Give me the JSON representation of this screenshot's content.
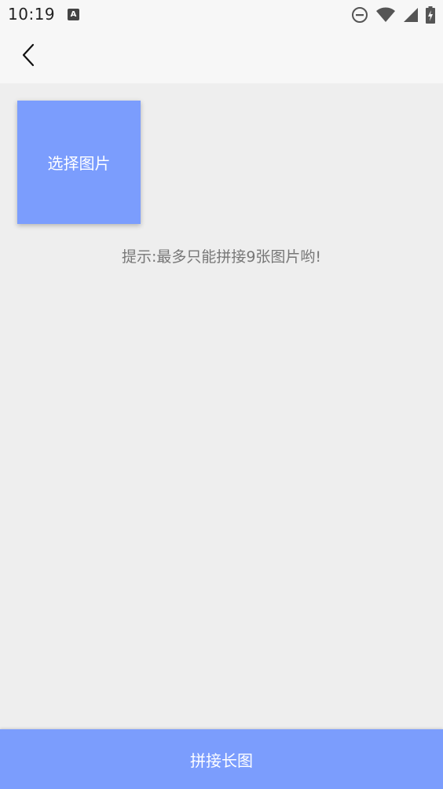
{
  "status_bar": {
    "time": "10:19",
    "icons": [
      "a-notification-icon",
      "do-not-disturb-icon",
      "wifi-icon",
      "cell-signal-icon",
      "battery-charging-icon"
    ]
  },
  "app_bar": {
    "back_icon": "chevron-left-icon"
  },
  "main": {
    "select_button_label": "选择图片",
    "hint_text": "提示:最多只能拼接9张图片哟!"
  },
  "footer": {
    "stitch_button_label": "拼接长图"
  },
  "colors": {
    "accent": "#7b9dfd",
    "background": "#eeeeee",
    "bar_background": "#f7f7f7",
    "hint_text": "#777777"
  }
}
